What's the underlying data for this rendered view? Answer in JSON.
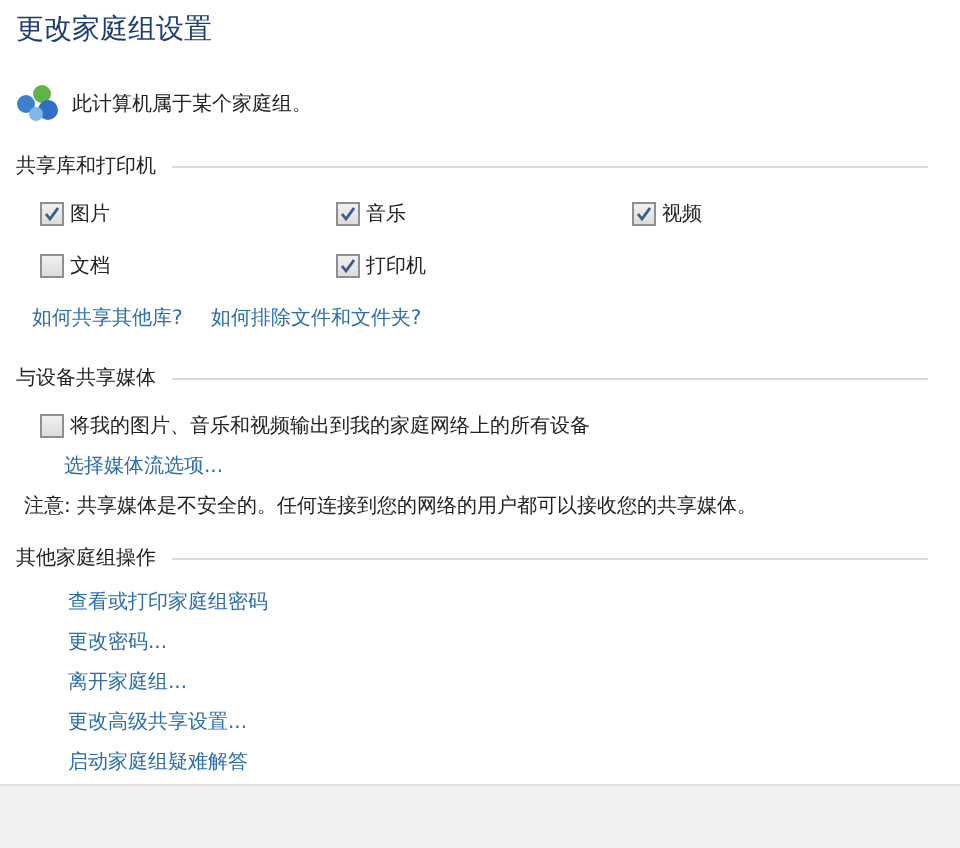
{
  "title": "更改家庭组设置",
  "status": "此计算机属于某个家庭组。",
  "libraries": {
    "heading": "共享库和打印机",
    "items": [
      {
        "label": "图片",
        "checked": true
      },
      {
        "label": "音乐",
        "checked": true
      },
      {
        "label": "视频",
        "checked": true
      },
      {
        "label": "文档",
        "checked": false
      },
      {
        "label": "打印机",
        "checked": true
      }
    ],
    "links": [
      "如何共享其他库?",
      "如何排除文件和文件夹?"
    ]
  },
  "media": {
    "heading": "与设备共享媒体",
    "option": {
      "label": "将我的图片、音乐和视频输出到我的家庭网络上的所有设备",
      "checked": false
    },
    "link": "选择媒体流选项...",
    "note": "注意: 共享媒体是不安全的。任何连接到您的网络的用户都可以接收您的共享媒体。"
  },
  "actions": {
    "heading": "其他家庭组操作",
    "links": [
      "查看或打印家庭组密码",
      "更改密码...",
      "离开家庭组...",
      "更改高级共享设置...",
      "启动家庭组疑难解答"
    ]
  }
}
